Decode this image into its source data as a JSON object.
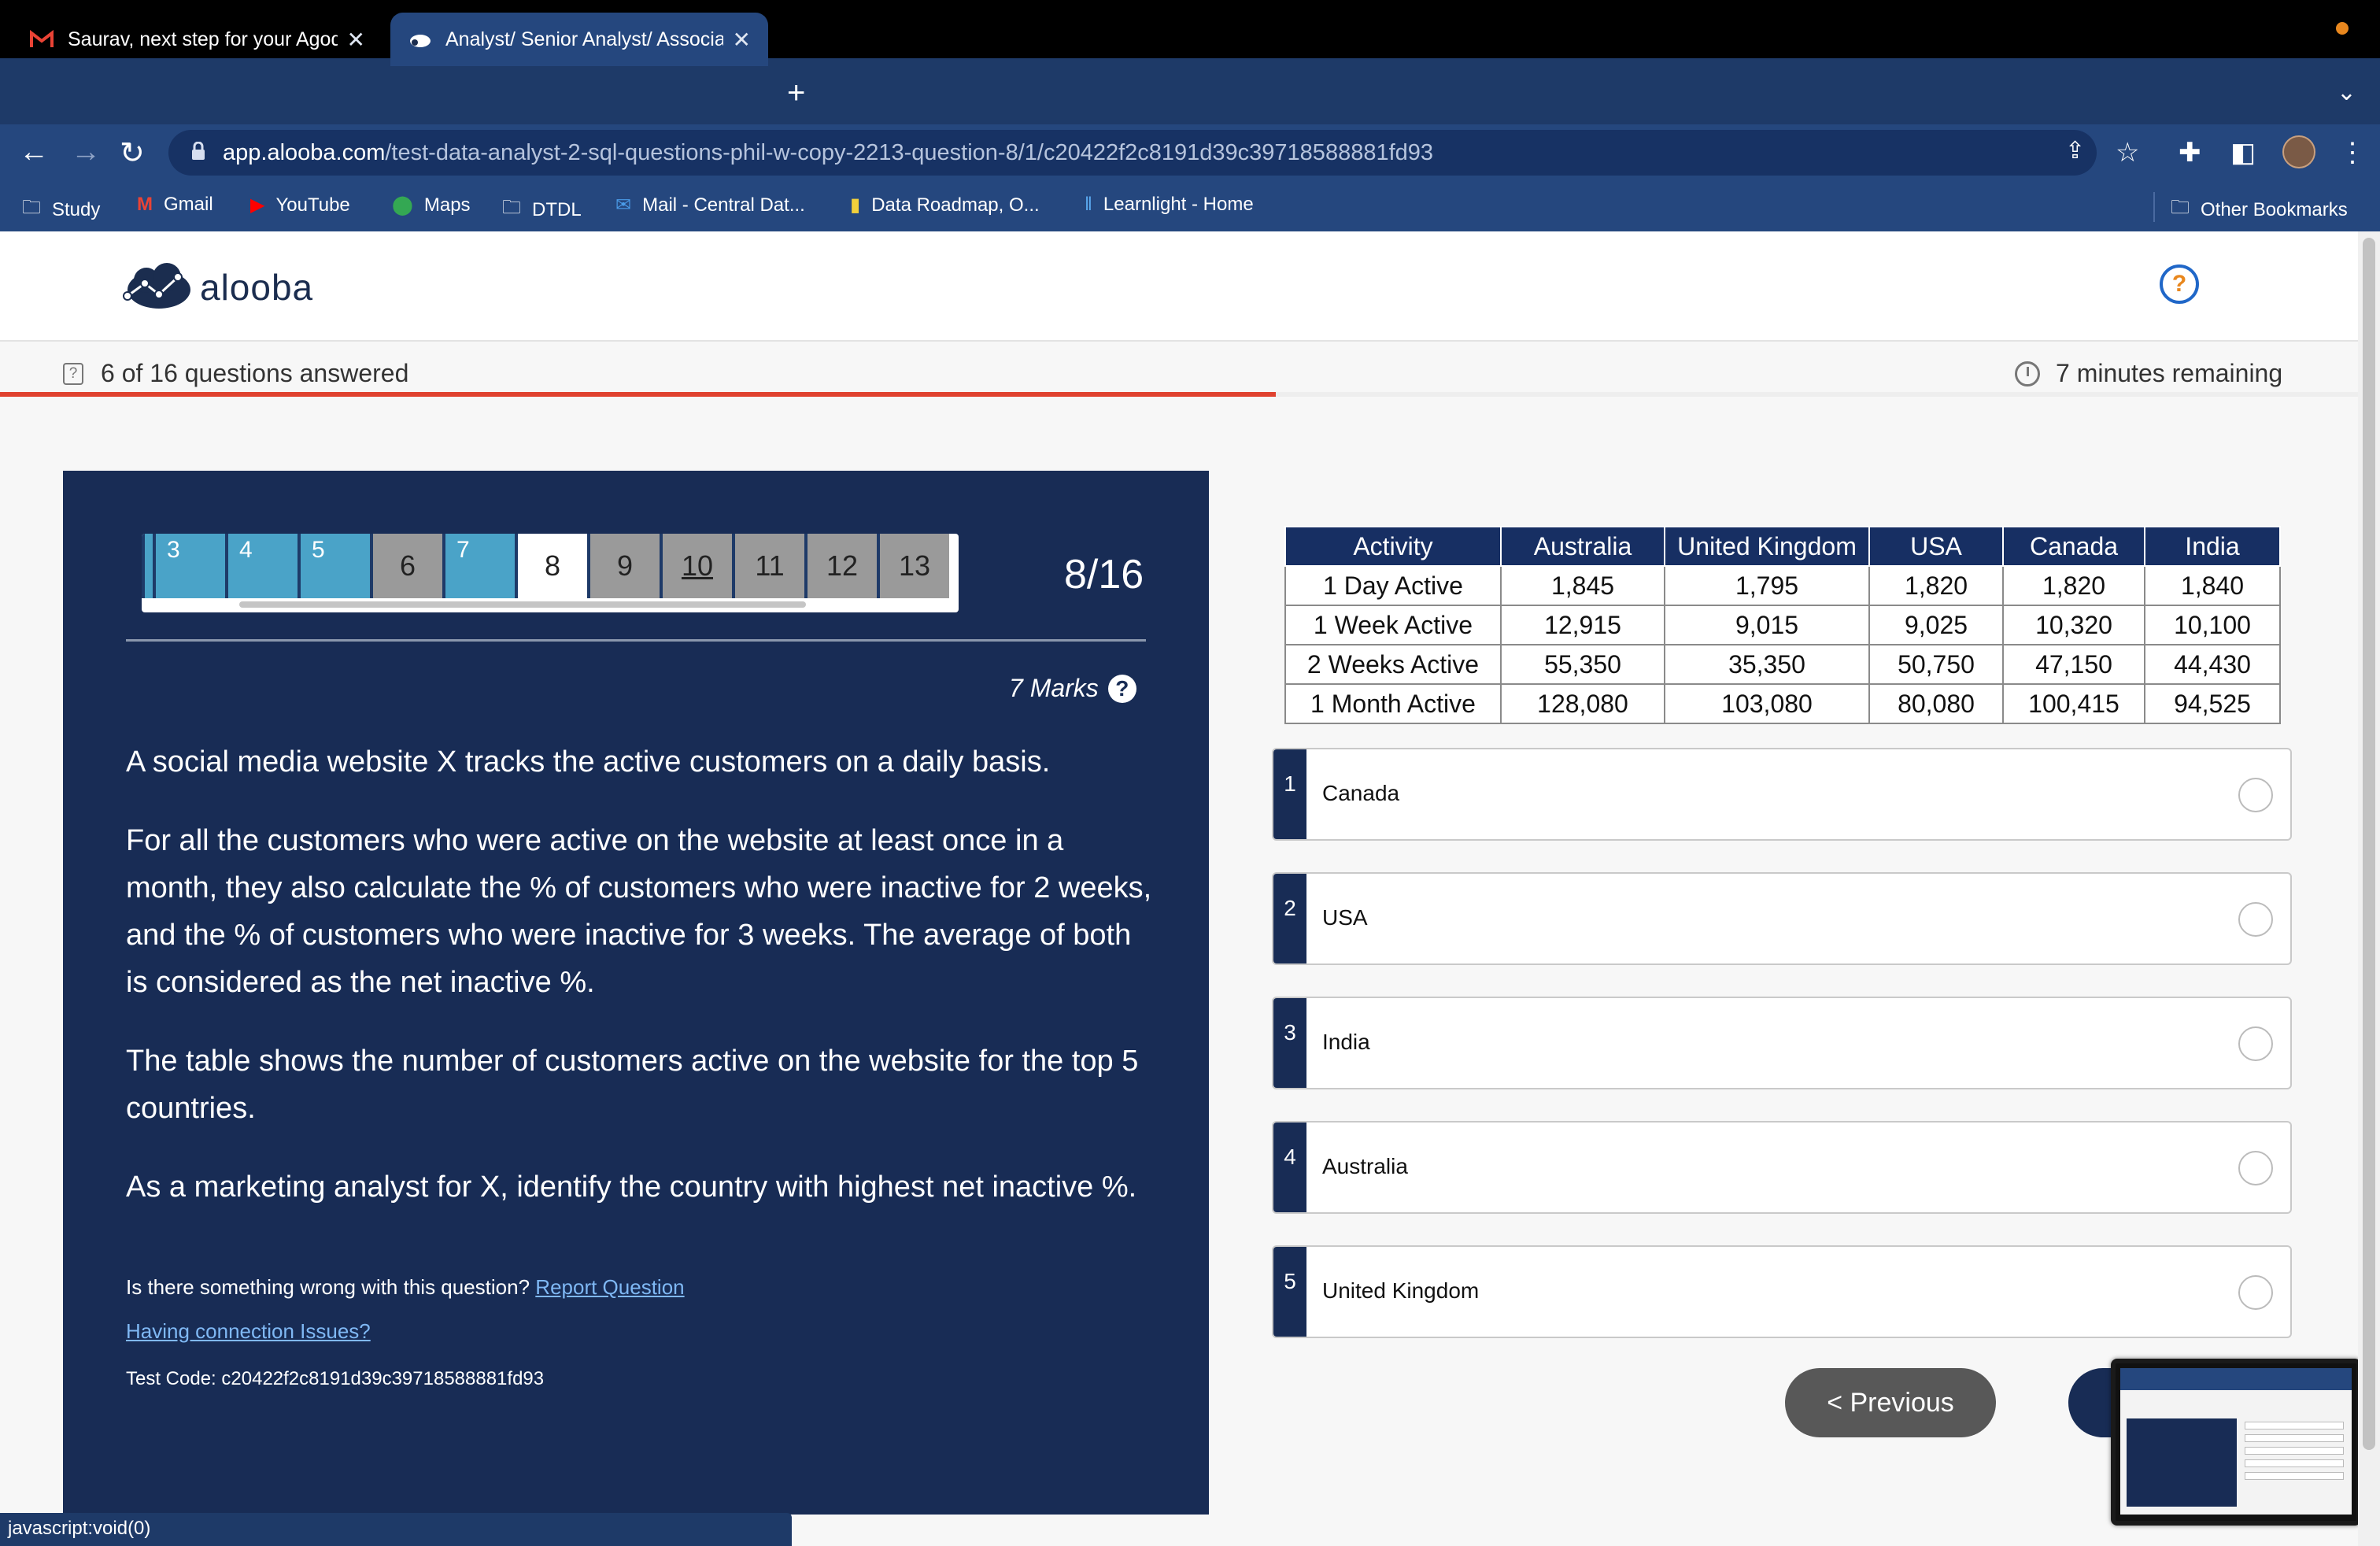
{
  "browser": {
    "tabs": [
      {
        "title": "Saurav, next step for your Agoda application",
        "active": false
      },
      {
        "title": "Analyst/ Senior Analyst/ Associate",
        "active": true
      }
    ],
    "url_host": "app.alooba.com",
    "url_path": "/test-data-analyst-2-sql-questions-phil-w-copy-2213-question-8/1/c20422f2c8191d39c39718588881fd93",
    "bookmarks": [
      "Study",
      "Gmail",
      "YouTube",
      "Maps",
      "DTDL",
      "Mail - Central Dat...",
      "Data Roadmap, O...",
      "Learnlight - Home"
    ],
    "other_bookmarks": "Other Bookmarks",
    "status_text": "javascript:void(0)"
  },
  "header": {
    "brand": "alooba",
    "help_symbol": "?"
  },
  "progress": {
    "answered_text": "6 of 16 questions answered",
    "remaining_text": "7 minutes remaining",
    "fraction_answered": 0.375,
    "bar_color": "#e0422f"
  },
  "question": {
    "nav_cells": [
      {
        "label": "",
        "state": "answered"
      },
      {
        "label": "3",
        "state": "answered"
      },
      {
        "label": "4",
        "state": "answered"
      },
      {
        "label": "5",
        "state": "answered"
      },
      {
        "label": "6",
        "state": "seen"
      },
      {
        "label": "7",
        "state": "answered"
      },
      {
        "label": "8",
        "state": "current"
      },
      {
        "label": "9",
        "state": "seen"
      },
      {
        "label": "10",
        "state": "seen-underlined"
      },
      {
        "label": "11",
        "state": "seen"
      },
      {
        "label": "12",
        "state": "seen"
      },
      {
        "label": "13",
        "state": "seen"
      }
    ],
    "counter": "8/16",
    "marks": "7 Marks",
    "marks_help": "?",
    "paragraphs": [
      "A social media website X tracks the active customers on a daily basis.",
      "For all the customers who were active on the website at least once in a month, they also calculate the % of customers who were inactive for 2 weeks, and the % of customers who were inactive for 3 weeks. The average of both is considered as the net inactive %.",
      "The table shows the number of customers active on the website for the top 5 countries.",
      "As a marketing analyst for X, identify the country with highest net inactive %."
    ],
    "report_prompt": "Is there something wrong with this question?",
    "report_link": "Report Question",
    "connection_link": "Having connection Issues?",
    "test_code": "Test Code: c20422f2c8191d39c39718588881fd93"
  },
  "table": {
    "headers": [
      "Activity",
      "Australia",
      "United Kingdom",
      "USA",
      "Canada",
      "India"
    ],
    "rows": [
      [
        "1 Day Active",
        "1,845",
        "1,795",
        "1,820",
        "1,820",
        "1,840"
      ],
      [
        "1 Week Active",
        "12,915",
        "9,015",
        "9,025",
        "10,320",
        "10,100"
      ],
      [
        "2 Weeks Active",
        "55,350",
        "35,350",
        "50,750",
        "47,150",
        "44,430"
      ],
      [
        "1 Month Active",
        "128,080",
        "103,080",
        "80,080",
        "100,415",
        "94,525"
      ]
    ]
  },
  "options": [
    {
      "num": "1",
      "label": "Canada"
    },
    {
      "num": "2",
      "label": "USA"
    },
    {
      "num": "3",
      "label": "India"
    },
    {
      "num": "4",
      "label": "Australia"
    },
    {
      "num": "5",
      "label": "United Kingdom"
    }
  ],
  "buttons": {
    "previous": "< Previous"
  },
  "colors": {
    "panel": "#182c55",
    "answered_cell": "#4aa3c8",
    "seen_cell": "#9a9a9a"
  }
}
